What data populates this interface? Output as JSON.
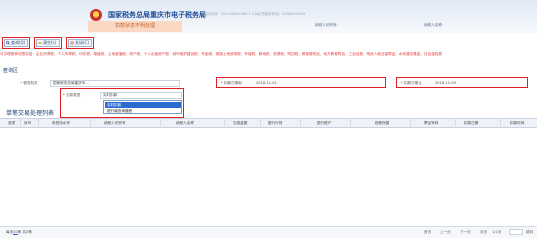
{
  "header": {
    "brand": "国家税务总局重庆市电子税务局",
    "brand_sub": "服务热线：023-96822366-1  CA证书服务热线：4008820009",
    "page_title": "扣款状态不明处理",
    "taxpayer_id_label": "纳税人识别号：",
    "taxpayer_name_label": "纳税人名称："
  },
  "toolbar": {
    "query_label": "查询(Q)",
    "clear_label": "清空(L)",
    "close_label": "关闭(C)"
  },
  "hint_text": "可办理费种仅限包括：企业所得税、个人所得税、印花税、增值税、土地增值税、房产税、个人出租房产税、城市维护建设税、车船税、城镇土地使用税、环保税、耕地税、资源税、附加税、教育费附加、地方教育附加、工会经费、残疾人就业保障金、水利建设基金、社会保险费",
  "query": {
    "section_title": "查询区",
    "fields": [
      {
        "label": "税务机关",
        "value": "国家税务总局重庆市..."
      },
      {
        "label": "扣款日期起",
        "value": "2018-11-01",
        "required": true
      },
      {
        "label": "扣款日期止",
        "value": "2018-11-09",
        "required": true
      },
      {
        "label": "交易类型",
        "value": "实时扣款",
        "required": true
      }
    ],
    "dropdown_options": [
      "实时扣款",
      "银行端查询缴税"
    ],
    "selected_option": "实时扣款"
  },
  "grid": {
    "title": "单笔交易处理列表",
    "columns": [
      "选项",
      "序号",
      "系统流水号",
      "纳税人识别号",
      "纳税人名称",
      "交易金额",
      "银行行别",
      "银行账户",
      "税款所属",
      "票证号码",
      "扣款日期",
      "扣款时间"
    ]
  },
  "footer": {
    "per_page_prefix": "每页",
    "per_page_value": "20",
    "per_page_suffix": "条 共0条",
    "first": "首页",
    "prev": "上一页",
    "next": "下一页",
    "last": "末页",
    "page_info": "1/1页",
    "jump": "跳转"
  },
  "colors": {
    "accent": "#e02020",
    "brand": "#1e4e95",
    "title_tab": "#fbd8c4",
    "selection": "#2d6bd0"
  }
}
